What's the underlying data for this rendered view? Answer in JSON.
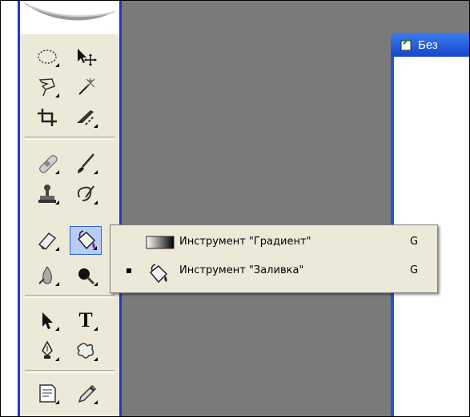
{
  "document": {
    "title": "Без"
  },
  "toolbox": {
    "tools": [
      {
        "name": "marquee-ellipse-tool",
        "icon": "ellipse-marquee-icon"
      },
      {
        "name": "move-tool",
        "icon": "move-icon"
      },
      {
        "name": "lasso-tool",
        "icon": "polygonal-lasso-icon"
      },
      {
        "name": "magic-wand-tool",
        "icon": "magic-wand-icon"
      },
      {
        "name": "crop-tool",
        "icon": "crop-icon"
      },
      {
        "name": "slice-tool",
        "icon": "slice-icon"
      },
      {
        "name": "healing-brush-tool",
        "icon": "bandage-icon"
      },
      {
        "name": "brush-tool",
        "icon": "brush-icon"
      },
      {
        "name": "clone-stamp-tool",
        "icon": "stamp-icon"
      },
      {
        "name": "history-brush-tool",
        "icon": "history-brush-icon"
      },
      {
        "name": "eraser-tool",
        "icon": "eraser-icon"
      },
      {
        "name": "paint-bucket-tool",
        "icon": "paint-bucket-icon"
      },
      {
        "name": "blur-tool",
        "icon": "blur-drop-icon"
      },
      {
        "name": "dodge-tool",
        "icon": "dodge-icon"
      },
      {
        "name": "path-selection-tool",
        "icon": "arrow-icon"
      },
      {
        "name": "type-tool",
        "icon": "type-icon",
        "glyph": "T"
      },
      {
        "name": "pen-tool",
        "icon": "pen-icon"
      },
      {
        "name": "custom-shape-tool",
        "icon": "shape-icon"
      },
      {
        "name": "notes-tool",
        "icon": "notes-icon"
      },
      {
        "name": "eyedropper-tool",
        "icon": "eyedropper-icon"
      }
    ]
  },
  "flyout": {
    "items": [
      {
        "label": "Инструмент \"Градиент\"",
        "shortcut": "G",
        "icon": "gradient-icon",
        "selected": false
      },
      {
        "label": "Инструмент \"Заливка\"",
        "shortcut": "G",
        "icon": "paint-bucket-icon",
        "selected": true
      }
    ]
  }
}
